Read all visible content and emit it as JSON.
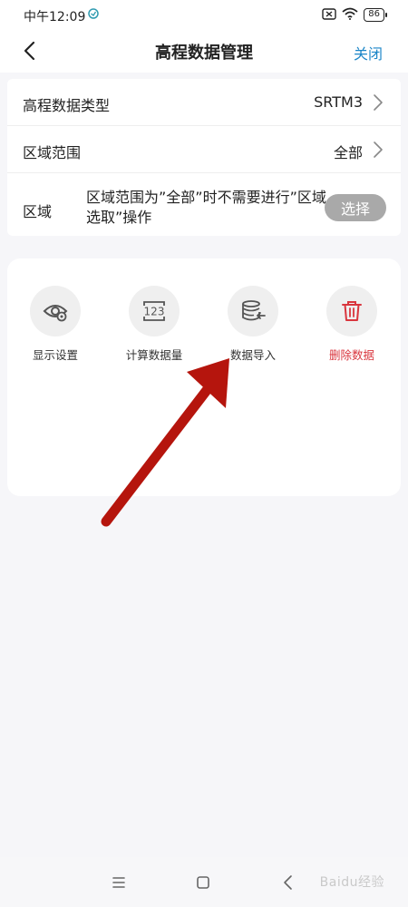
{
  "status_bar": {
    "time": "中午12:09",
    "app_icon": "app-notification-icon",
    "battery": "86"
  },
  "header": {
    "back_icon": "chevron-left-icon",
    "title": "高程数据管理",
    "close_label": "关闭"
  },
  "settings": {
    "rows": [
      {
        "label": "高程数据类型",
        "value": "SRTM3"
      },
      {
        "label": "区域范围",
        "value": "全部"
      }
    ],
    "region": {
      "label": "区域",
      "description": "区域范围为”全部”时不需要进行”区域选取”操作",
      "button_label": "选择"
    }
  },
  "actions": [
    {
      "label": "显示设置",
      "icon": "eye-settings-icon"
    },
    {
      "label": "计算数据量",
      "icon": "number-123-icon"
    },
    {
      "label": "数据导入",
      "icon": "database-import-icon"
    },
    {
      "label": "删除数据",
      "icon": "trash-icon"
    }
  ],
  "colors": {
    "accent": "#1c86c8",
    "danger": "#d9363e",
    "annotation_arrow": "#b5150d",
    "button_disabled": "#a9a9a9"
  },
  "watermark": "Baidu经验"
}
